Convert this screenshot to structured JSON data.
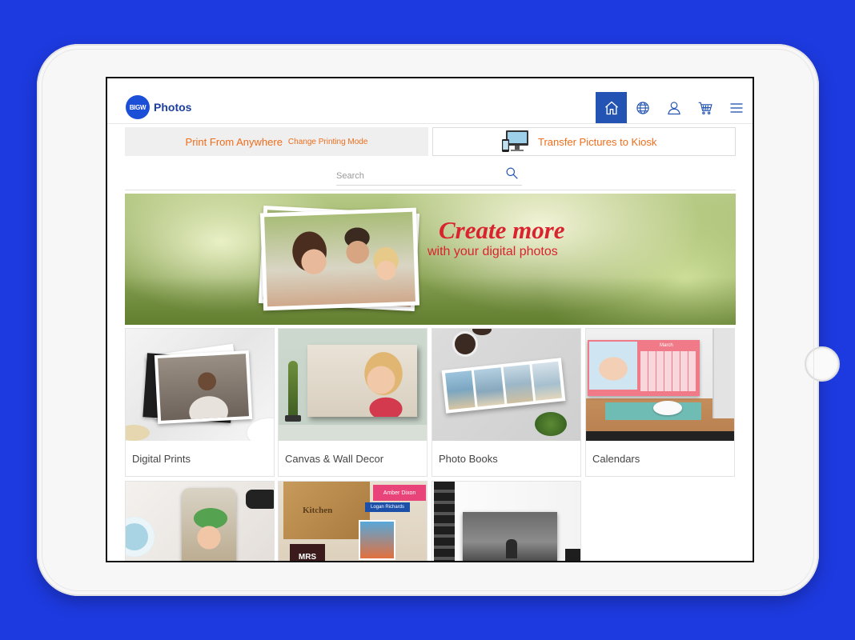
{
  "app": {
    "brand_badge": "BIGW",
    "brand_name": "Photos"
  },
  "nav": [
    {
      "name": "home",
      "icon": "home-icon",
      "active": true
    },
    {
      "name": "language",
      "icon": "globe-icon",
      "active": false
    },
    {
      "name": "account",
      "icon": "user-icon",
      "active": false
    },
    {
      "name": "cart",
      "icon": "cart-icon",
      "active": false
    },
    {
      "name": "menu",
      "icon": "hamburger-menu-icon",
      "active": false
    }
  ],
  "mode": {
    "print_label": "Print From Anywhere",
    "change_label": "Change Printing Mode",
    "transfer_label": "Transfer Pictures to Kiosk"
  },
  "search": {
    "placeholder": "Search"
  },
  "hero": {
    "title": "Create more",
    "subtitle": "with your digital photos"
  },
  "products": [
    {
      "label": "Digital Prints"
    },
    {
      "label": "Canvas & Wall Decor"
    },
    {
      "label": "Photo Books"
    },
    {
      "label": "Calendars"
    }
  ],
  "row2_text": {
    "kitchen_sign": "Kitchen",
    "name_tag_1": "Amber Dixon",
    "name_tag_2": "Logan Richards",
    "mug_text": "MRS"
  },
  "calendar_month": "March",
  "colors": {
    "background": "#1d3ae0",
    "brand_blue": "#2354b3",
    "accent_orange": "#ee6d1b",
    "hero_red": "#d9232e"
  }
}
